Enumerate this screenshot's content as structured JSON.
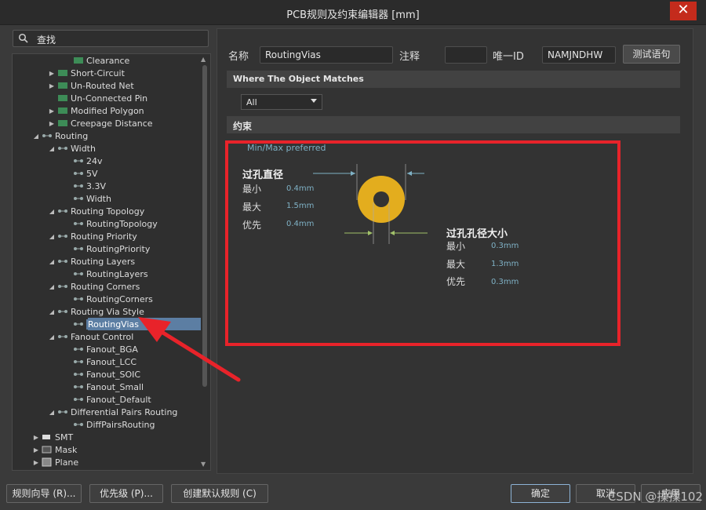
{
  "window": {
    "title": "PCB规则及约束编辑器 [mm]"
  },
  "search": {
    "text": "查找"
  },
  "tree": {
    "items": [
      {
        "label": "Clearance"
      },
      {
        "label": "Short-Circuit"
      },
      {
        "label": "Un-Routed Net"
      },
      {
        "label": "Un-Connected Pin"
      },
      {
        "label": "Modified Polygon"
      },
      {
        "label": "Creepage Distance"
      },
      {
        "label": "Routing"
      },
      {
        "label": "Width"
      },
      {
        "label": "24v"
      },
      {
        "label": "5V"
      },
      {
        "label": "3.3V"
      },
      {
        "label": "Width"
      },
      {
        "label": "Routing Topology"
      },
      {
        "label": "RoutingTopology"
      },
      {
        "label": "Routing Priority"
      },
      {
        "label": "RoutingPriority"
      },
      {
        "label": "Routing Layers"
      },
      {
        "label": "RoutingLayers"
      },
      {
        "label": "Routing Corners"
      },
      {
        "label": "RoutingCorners"
      },
      {
        "label": "Routing Via Style"
      },
      {
        "label": "RoutingVias"
      },
      {
        "label": "Fanout Control"
      },
      {
        "label": "Fanout_BGA"
      },
      {
        "label": "Fanout_LCC"
      },
      {
        "label": "Fanout_SOIC"
      },
      {
        "label": "Fanout_Small"
      },
      {
        "label": "Fanout_Default"
      },
      {
        "label": "Differential Pairs Routing"
      },
      {
        "label": "DiffPairsRouting"
      },
      {
        "label": "SMT"
      },
      {
        "label": "Mask"
      },
      {
        "label": "Plane"
      }
    ]
  },
  "form": {
    "name_label": "名称",
    "name_value": "RoutingVias",
    "comment_label": "注释",
    "comment_value": "",
    "uid_label": "唯一ID",
    "uid_value": "NAMJNDHW",
    "test_button": "测试语句"
  },
  "where": {
    "header": "Where The Object Matches",
    "dropdown_value": "All"
  },
  "constraints": {
    "header": "约束",
    "min_max_preferred": "Min/Max preferred",
    "via_diameter": {
      "title": "过孔直径",
      "min_label": "最小",
      "min": "0.4mm",
      "max_label": "最大",
      "max": "1.5mm",
      "pref_label": "优先",
      "pref": "0.4mm"
    },
    "hole_size": {
      "title": "过孔孔径大小",
      "min_label": "最小",
      "min": "0.3mm",
      "max_label": "最大",
      "max": "1.3mm",
      "pref_label": "优先",
      "pref": "0.3mm"
    }
  },
  "buttons": {
    "rule_wizard": "规则向导 (R)...",
    "priorities": "优先级 (P)...",
    "create_default": "创建默认规则 (C)",
    "ok": "确定",
    "cancel": "取消",
    "apply": "应用"
  },
  "watermark": "CSDN @揉揉102",
  "colors": {
    "accent_red": "#e8232a",
    "selection": "#5c7ea3",
    "via_ring": "#e3ad1e"
  }
}
